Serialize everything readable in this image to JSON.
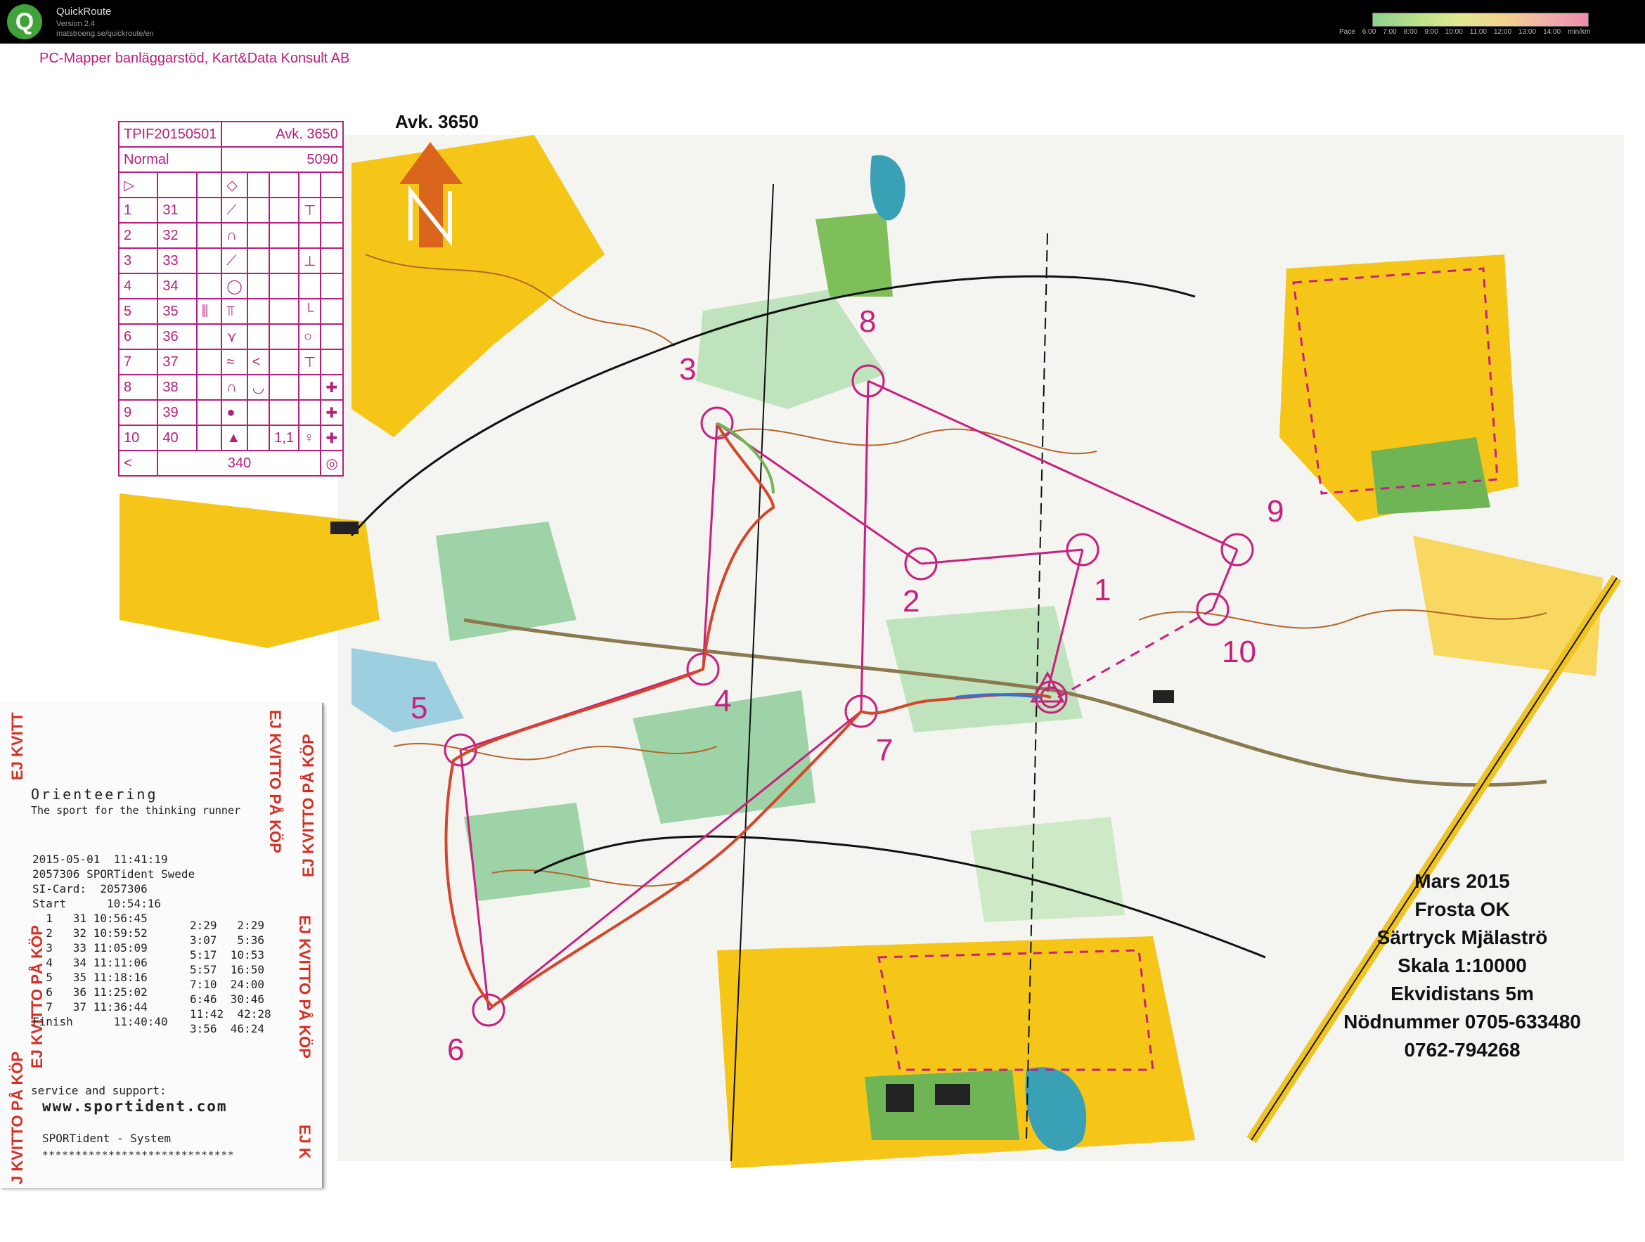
{
  "app": {
    "title": "QuickRoute",
    "version": "Version 2.4",
    "url": "matstroeng.se/quickroute/en",
    "logo_letter": "Q",
    "pace_label": "Pace",
    "pace_ticks": [
      "6:00",
      "7:00",
      "8:00",
      "9:00",
      "10:00",
      "11:00",
      "12:00",
      "13:00",
      "14:00"
    ],
    "pace_unit": "min/km"
  },
  "map": {
    "header_credit": "PC-Mapper banläggarstöd, Kart&Data Konsult AB",
    "avk_label": "Avk. 3650",
    "course": {
      "event": "TPIF20150501",
      "avk": "Avk. 3650",
      "class": "Normal",
      "length": "5090",
      "total_climb": "340",
      "controls": [
        {
          "n": "1",
          "code": "31"
        },
        {
          "n": "2",
          "code": "32"
        },
        {
          "n": "3",
          "code": "33"
        },
        {
          "n": "4",
          "code": "34"
        },
        {
          "n": "5",
          "code": "35"
        },
        {
          "n": "6",
          "code": "36"
        },
        {
          "n": "7",
          "code": "37"
        },
        {
          "n": "8",
          "code": "38"
        },
        {
          "n": "9",
          "code": "39"
        },
        {
          "n": "10",
          "code": "40"
        }
      ],
      "dim_note": "1,1"
    },
    "control_labels": [
      "1",
      "2",
      "3",
      "4",
      "5",
      "6",
      "7",
      "8",
      "9",
      "10"
    ],
    "info": {
      "line1": "Mars 2015",
      "line2": "Frosta OK",
      "line3": "Särtryck Mjälaströ",
      "line4": "Skala 1:10000",
      "line5": "Ekvidistans 5m",
      "line6": "Nödnummer 0705-633480",
      "line7": "0762-794268"
    },
    "colors": {
      "course": "#c8207e",
      "open_land": "#f5c518",
      "forest_green": "#7fbf5a",
      "water": "#3aa0b5",
      "contour": "#b5652a",
      "route": "#d4462a"
    }
  },
  "receipt": {
    "stamp": "EJ KVITTO PÅ KÖP",
    "stamp_short": "EJ KVITT",
    "stamp_tail": "J KVITTO PÅ KÖP",
    "stamp_edge": "EJ K",
    "title": "Orienteering",
    "subtitle": "The sport for the thinking runner",
    "body": "2015-05-01  11:41:19\n2057306 SPORTident Swede\nSI-Card:  2057306\nStart      10:54:16\n  1   31 10:56:45\n  2   32 10:59:52\n  3   33 11:05:09\n  4   34 11:11:06\n  5   35 11:18:16\n  6   36 11:25:02\n  7   37 11:36:44\nFinish      11:40:40",
    "splits": "2:29   2:29\n3:07   5:36\n5:17  10:53\n5:57  16:50\n7:10  24:00\n6:46  30:46\n11:42  42:28\n3:56  46:24",
    "service": "service and support:",
    "website": "www.sportident.com",
    "system": "SPORTident - System",
    "barcode": "*****************************"
  }
}
